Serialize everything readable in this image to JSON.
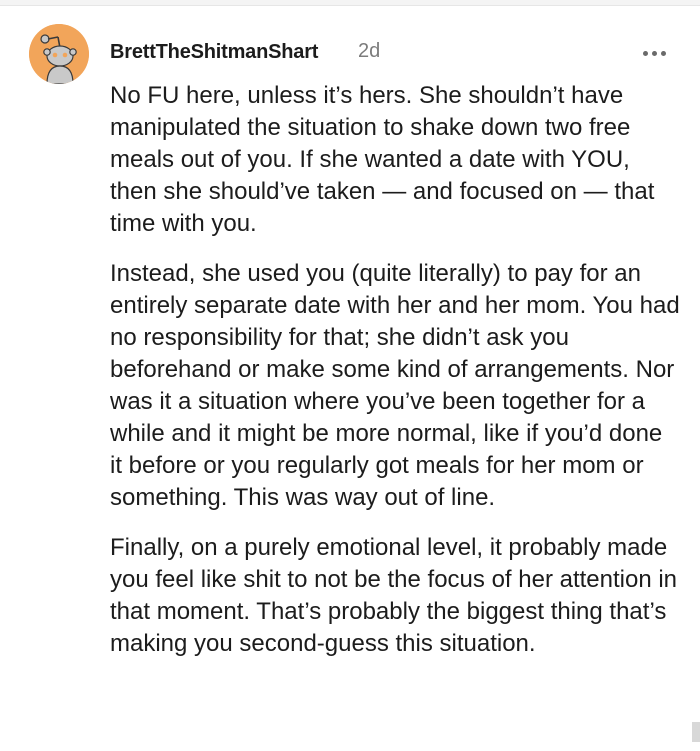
{
  "comment": {
    "username": "BrettTheShitmanShart",
    "timestamp": "2d",
    "avatar_icon": "snoo-avatar-icon",
    "more_icon": "more-options-icon",
    "paragraphs": [
      "No FU here, unless it’s hers. She shouldn’t have manipulated the situation to shake down two free meals out of you. If she wanted a date with YOU, then she should’ve taken — and focused on — that time with you.",
      "Instead, she used you (quite literally) to pay for an entirely separate date with her and her mom. You had no responsibility for that; she didn’t ask you beforehand or make some kind of arrangements. Nor was it a situation where you’ve been together for a while and it might be more normal, like if you’d done it before or you regularly got meals for her mom or something. This was way out of line.",
      "Finally, on a purely emotional level, it probably made you feel like shit to not be the focus of her attention in that moment. That’s probably the biggest thing that’s making you second-guess this situation."
    ]
  },
  "colors": {
    "avatar_bg": "#f2a55a",
    "text": "#1c1c1c",
    "meta": "#7c7c7c"
  }
}
